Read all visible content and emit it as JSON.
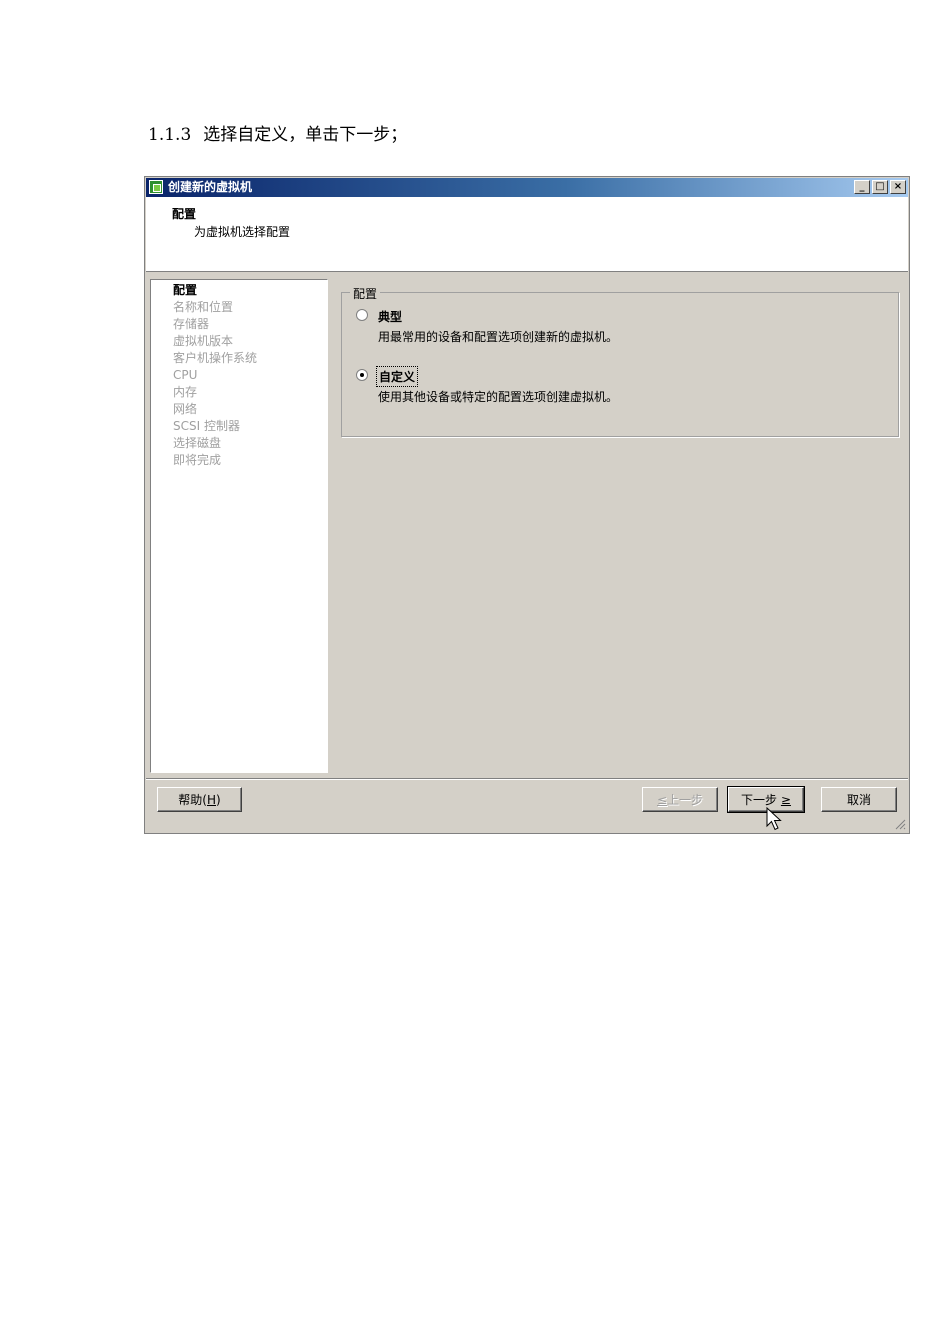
{
  "document": {
    "section_number": "1.1.3",
    "section_text": "选择自定义，单击下一步；"
  },
  "window": {
    "title": "创建新的虚拟机",
    "controls": {
      "minimize": "_",
      "maximize": "□",
      "close": "×"
    }
  },
  "header": {
    "title": "配置",
    "subtitle": "为虚拟机选择配置"
  },
  "steps": [
    {
      "label": "配置",
      "current": true
    },
    {
      "label": "名称和位置",
      "current": false
    },
    {
      "label": "存储器",
      "current": false
    },
    {
      "label": "虚拟机版本",
      "current": false
    },
    {
      "label": "客户机操作系统",
      "current": false
    },
    {
      "label": "CPU",
      "current": false
    },
    {
      "label": "内存",
      "current": false
    },
    {
      "label": "网络",
      "current": false
    },
    {
      "label": "SCSI 控制器",
      "current": false
    },
    {
      "label": "选择磁盘",
      "current": false
    },
    {
      "label": "即将完成",
      "current": false
    }
  ],
  "config_group": {
    "legend": "配置",
    "options": [
      {
        "label": "典型",
        "description": "用最常用的设备和配置选项创建新的虚拟机。",
        "selected": false
      },
      {
        "label": "自定义",
        "description": "使用其他设备或特定的配置选项创建虚拟机。",
        "selected": true
      }
    ]
  },
  "footer": {
    "help": {
      "text": "帮助(",
      "mnemonic": "H",
      "suffix": ")"
    },
    "back": {
      "prefix": "≤",
      "text": "上一步",
      "enabled": false
    },
    "next": {
      "text": "下一步",
      "suffix": "≥",
      "enabled": true
    },
    "cancel": {
      "text": "取消"
    }
  },
  "icons": {
    "app": "vm-app-icon",
    "cursor": "mouse-pointer-icon",
    "grip": "resize-grip-icon"
  }
}
